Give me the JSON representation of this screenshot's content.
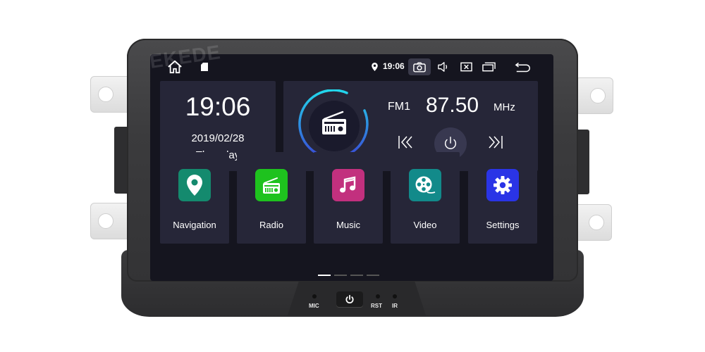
{
  "brand_watermark": "EKEDE",
  "status_bar": {
    "home_icon": "home-icon",
    "notification_icon": "sd-card-icon",
    "location_icon": "location-pin-icon",
    "time": "19:06",
    "icons": [
      "screenshot-camera-icon",
      "volume-icon",
      "close-app-icon",
      "recent-apps-icon",
      "back-icon"
    ]
  },
  "clock_widget": {
    "time": "19:06",
    "date": "2019/02/28",
    "day": "Thursday"
  },
  "radio_widget": {
    "band": "FM1",
    "frequency": "87.50",
    "unit": "MHz",
    "controls": [
      "previous-icon",
      "power-icon",
      "next-icon"
    ],
    "ring_colors": [
      "#22d3e8",
      "#3a4fd8"
    ]
  },
  "apps": [
    {
      "label": "Navigation",
      "icon": "location-pin-icon",
      "color": "#148a6e"
    },
    {
      "label": "Radio",
      "icon": "radio-icon",
      "color": "#1ec21e"
    },
    {
      "label": "Music",
      "icon": "music-note-icon",
      "color": "#c2307e"
    },
    {
      "label": "Video",
      "icon": "film-reel-icon",
      "color": "#128a8a"
    },
    {
      "label": "Settings",
      "icon": "gear-icon",
      "color": "#2a34e6"
    }
  ],
  "pager": {
    "pages": 4,
    "current": 1
  },
  "hardware": {
    "mic_label": "MIC",
    "rst_label": "RST",
    "ir_label": "IR"
  }
}
